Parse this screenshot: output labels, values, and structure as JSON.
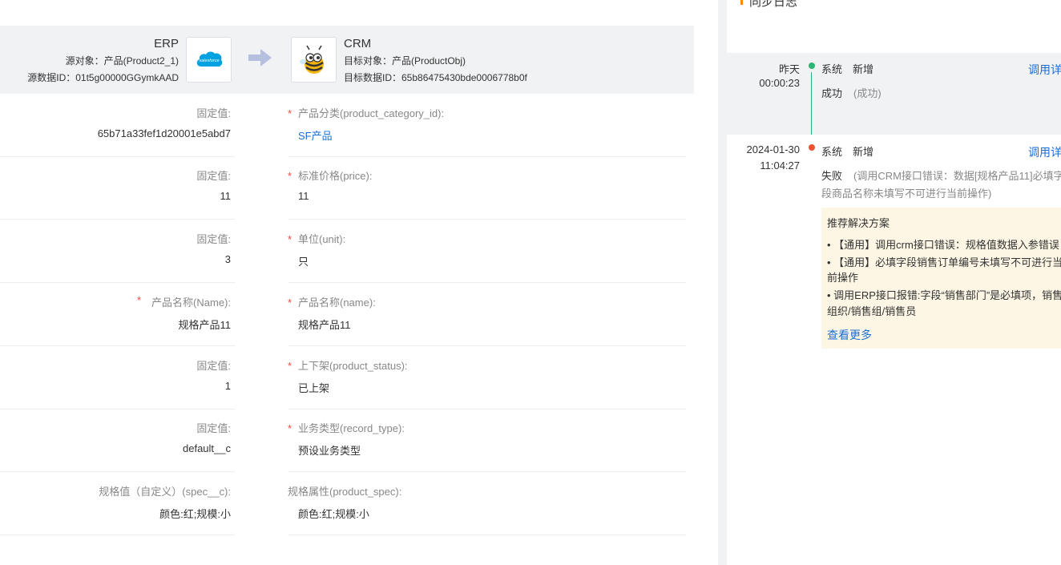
{
  "header": {
    "source": {
      "system": "ERP",
      "object_line": "源对象：产品(Product2_1)",
      "data_id_line": "源数据ID：01t5g00000GGymkAAD",
      "logo_text": "salesforce",
      "logo_color": "#00a1e0"
    },
    "target": {
      "system": "CRM",
      "object_line": "目标对象：产品(ProductObj)",
      "data_id_line": "目标数据ID：65b86475430bde0006778b0f"
    }
  },
  "rows": [
    {
      "src_label": "固定值:",
      "src_value": "65b71a33fef1d20001e5abd7",
      "tgt_label": "产品分类(product_category_id):",
      "tgt_value": "SF产品"
    },
    {
      "src_label": "固定值:",
      "src_value": "11",
      "tgt_label": "标准价格(price):",
      "tgt_value": "11"
    },
    {
      "src_label": "固定值:",
      "src_value": "3",
      "tgt_label": "单位(unit):",
      "tgt_value": "只"
    },
    {
      "src_label": "产品名称(Name):",
      "src_value": "规格产品11",
      "tgt_label": "产品名称(name):",
      "tgt_value": "规格产品11"
    },
    {
      "src_label": "固定值:",
      "src_value": "1",
      "tgt_label": "上下架(product_status):",
      "tgt_value": "已上架"
    },
    {
      "src_label": "固定值:",
      "src_value": "default__c",
      "tgt_label": "业务类型(record_type):",
      "tgt_value": "预设业务类型"
    },
    {
      "src_label": "规格值（自定义）(spec__c):",
      "src_value": "颜色:红;规模:小",
      "tgt_label": "规格属性(product_spec):",
      "tgt_value": "颜色:红;规模:小"
    }
  ],
  "required_mark": "*",
  "log": {
    "title": "同步日志",
    "entries": [
      {
        "date": "昨天",
        "time": "00:00:23",
        "source": "系统",
        "action": "新增",
        "status": "成功",
        "detail": "(成功)",
        "button": "调用详",
        "dot_color": "#2bb673"
      },
      {
        "date": "2024-01-30",
        "time": "11:04:27",
        "source": "系统",
        "action": "新增",
        "status": "失败",
        "detail": "(调用CRM接口错误：数据[规格产品11]必填字",
        "detail2": "段商品名称未填写不可进行当前操作)",
        "button": "调用详",
        "dot_color": "#f0522e"
      }
    ],
    "solution": {
      "title": "推荐解决方案",
      "lines": [
        "• 【通用】调用crm接口错误：规格值数据入参错误",
        "• 【通用】必填字段销售订单编号未填写不可进行当",
        "前操作",
        "• 调用ERP接口报错:字段“销售部门”是必填项，销售",
        "组织/销售组/销售员"
      ],
      "more": "查看更多"
    }
  }
}
